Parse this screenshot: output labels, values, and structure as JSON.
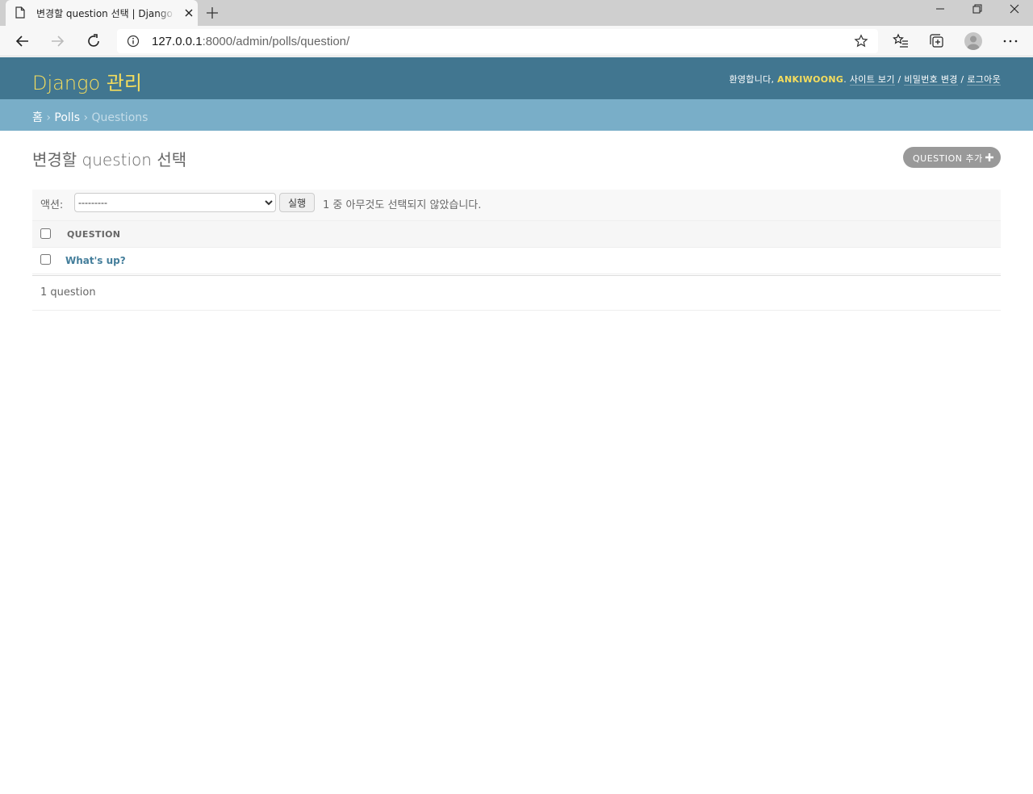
{
  "browser": {
    "tab_title": "변경할 question 선택 | Django 사이트 관리",
    "url_host": "127.0.0.1",
    "url_rest": ":8000/admin/polls/question/"
  },
  "header": {
    "branding": "Django 관리",
    "welcome": "환영합니다,",
    "username": "ANKIWOONG",
    "period": ".",
    "view_site": "사이트 보기",
    "sep1": " / ",
    "change_password": "비밀번호 변경",
    "sep2": " / ",
    "logout": "로그아웃"
  },
  "breadcrumbs": {
    "home": "홈",
    "sep": "›",
    "app": "Polls",
    "current": "Questions"
  },
  "content": {
    "title": "변경할 question 선택",
    "add_button": "QUESTION 추가"
  },
  "actions": {
    "label": "액션:",
    "selected": "---------",
    "go": "실행",
    "counter": "1 중 아무것도 선택되지 않았습니다."
  },
  "table": {
    "column": "QUESTION",
    "rows": [
      {
        "question": "What's up?"
      }
    ]
  },
  "paginator": "1 question"
}
